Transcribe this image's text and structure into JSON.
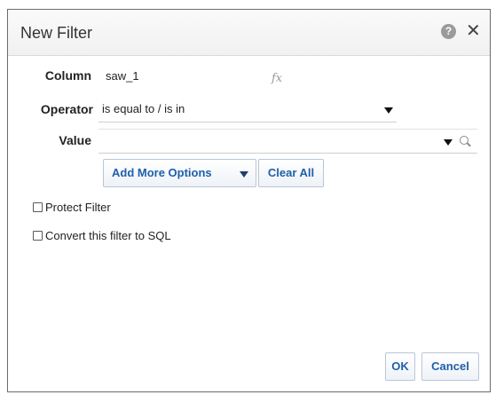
{
  "dialog": {
    "title": "New Filter",
    "help_icon": "help-icon",
    "close_icon": "close-icon"
  },
  "form": {
    "column_label": "Column",
    "column_value": "saw_1",
    "fx_icon": "fx",
    "operator_label": "Operator",
    "operator_value": "is equal to / is in",
    "value_label": "Value",
    "value_input": ""
  },
  "buttons": {
    "add_more_options": "Add More Options",
    "clear_all": "Clear All",
    "ok": "OK",
    "cancel": "Cancel"
  },
  "options": {
    "protect_filter": "Protect Filter",
    "protect_filter_checked": false,
    "convert_sql": "Convert this filter to SQL",
    "convert_sql_checked": false
  }
}
